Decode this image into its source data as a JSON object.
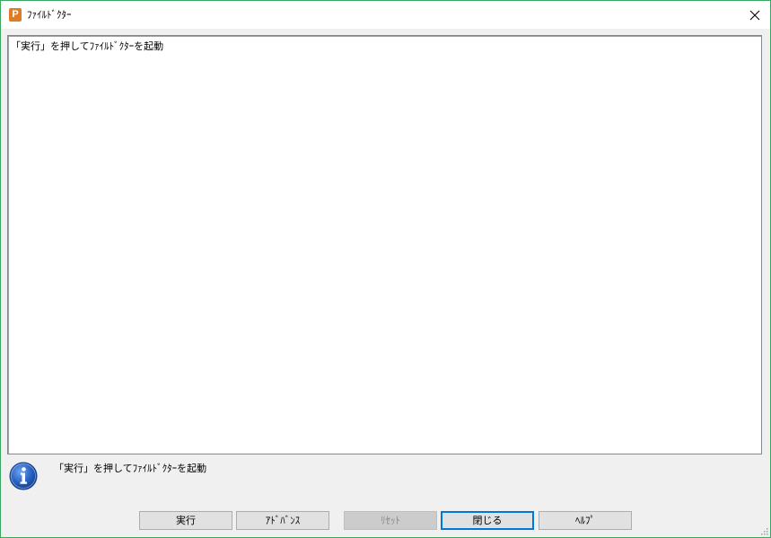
{
  "window": {
    "title": "ﾌｧｲﾙﾄﾞｸﾀｰ",
    "app_icon_letter": "P",
    "app_icon_color": "#e07b22",
    "border_color": "#3aa863"
  },
  "output": {
    "text": "「実行」を押してﾌｧｲﾙﾄﾞｸﾀｰを起動"
  },
  "status": {
    "icon": "info-icon",
    "message": "「実行」を押してﾌｧｲﾙﾄﾞｸﾀｰを起動"
  },
  "buttons": {
    "run": "実行",
    "advanced": "ｱﾄﾞﾊﾞﾝｽ",
    "reset": "ﾘｾｯﾄ",
    "close": "閉じる",
    "help": "ﾍﾙﾌﾟ"
  },
  "colors": {
    "accent": "#0078d7",
    "info_blue": "#1e5bb8"
  }
}
